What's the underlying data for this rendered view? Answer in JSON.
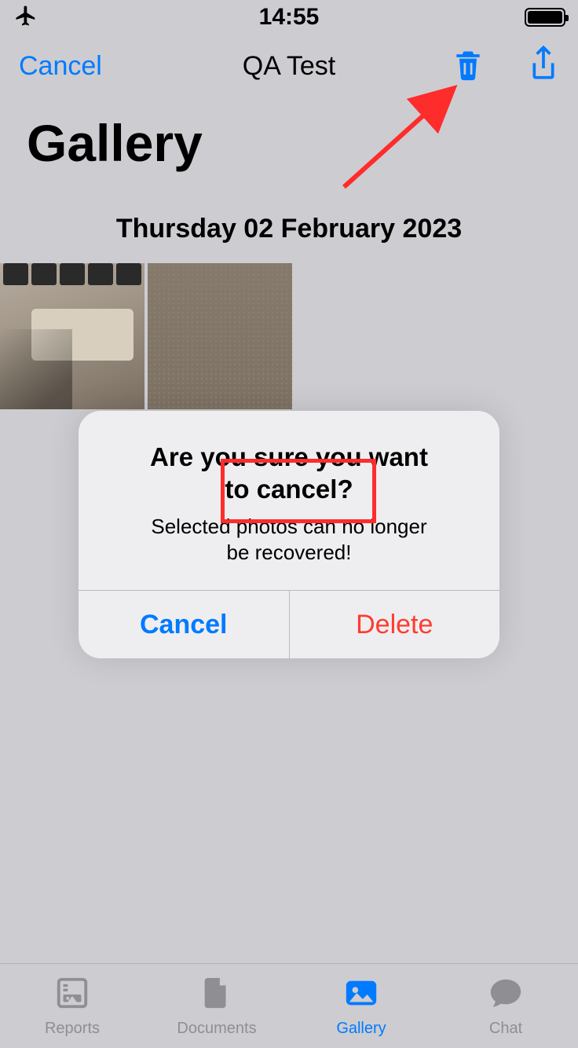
{
  "status": {
    "time": "14:55"
  },
  "nav": {
    "cancel": "Cancel",
    "title": "QA Test"
  },
  "page": {
    "heading": "Gallery",
    "section_date": "Thursday 02 February 2023"
  },
  "alert": {
    "title_line1": "Are you sure you want",
    "title_line2": "to cancel?",
    "message_line1": "Selected photos can no longer",
    "message_line2": "be recovered!",
    "cancel": "Cancel",
    "delete": "Delete"
  },
  "tabs": {
    "reports": "Reports",
    "documents": "Documents",
    "gallery": "Gallery",
    "chat": "Chat"
  },
  "colors": {
    "accent": "#007aff",
    "destructive": "#ff3b30",
    "annotation": "#ff2c2c"
  }
}
